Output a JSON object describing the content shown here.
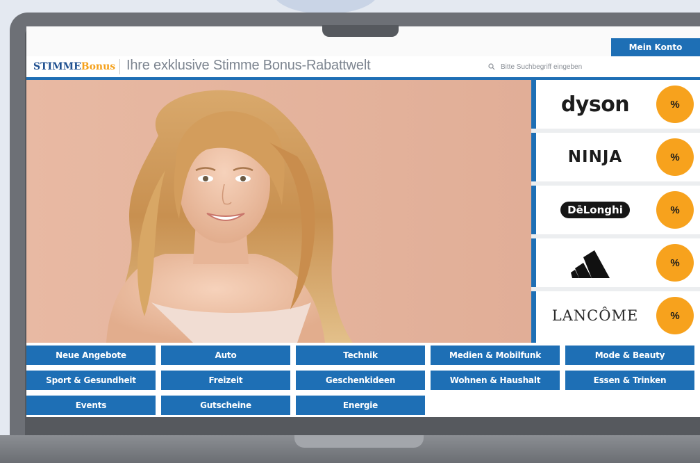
{
  "account": {
    "label": "Mein Konto"
  },
  "header": {
    "logo_part1": "STIMME",
    "logo_part2": "Bonus",
    "tagline": "Ihre exklusive Stimme Bonus-Rabattwelt",
    "search_placeholder": "Bitte Suchbegriff eingeben"
  },
  "brands": [
    {
      "name": "dyson",
      "badge": "%"
    },
    {
      "name": "NINJA",
      "badge": "%"
    },
    {
      "name": "DēLonghi",
      "badge": "%"
    },
    {
      "name": "adidas-logo",
      "badge": "%"
    },
    {
      "name": "LANCÔME",
      "badge": "%"
    }
  ],
  "categories": {
    "row1": [
      "Neue Angebote",
      "Auto",
      "Technik",
      "Medien & Mobilfunk",
      "Mode & Beauty"
    ],
    "row2": [
      "Sport & Gesundheit",
      "Freizeit",
      "Geschenkideen",
      "Wohnen & Haushalt",
      "Essen & Trinken"
    ],
    "row3": [
      "Events",
      "Gutscheine",
      "Energie"
    ]
  },
  "colors": {
    "accent_blue": "#1e6fb5",
    "badge_orange": "#f7a21d",
    "hero_background": "#e5b49e"
  },
  "icons": {
    "search": "search-icon",
    "hero": "woman-portrait-image"
  }
}
